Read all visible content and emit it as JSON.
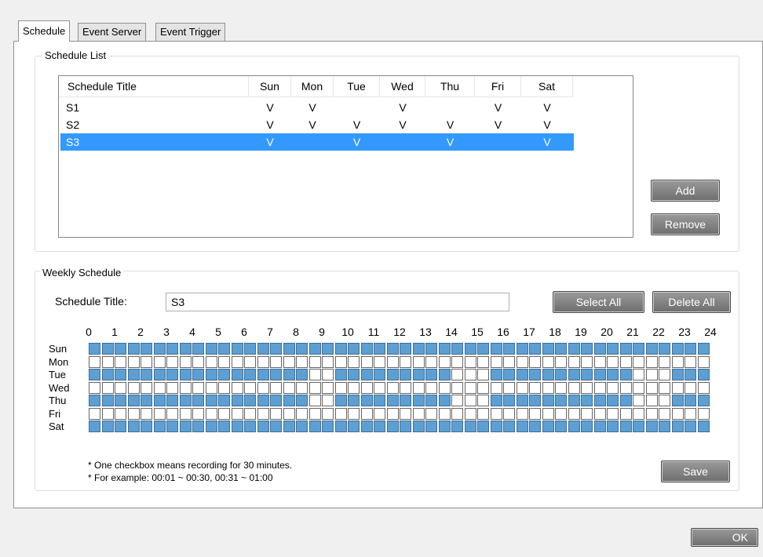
{
  "tabs": [
    "Schedule",
    "Event Server",
    "Event Trigger"
  ],
  "schedule_list": {
    "group_title": "Schedule List",
    "columns": [
      "Schedule Title",
      "Sun",
      "Mon",
      "Tue",
      "Wed",
      "Thu",
      "Fri",
      "Sat"
    ],
    "rows": [
      {
        "title": "S1",
        "days": [
          "V",
          "V",
          "",
          "V",
          "",
          "V",
          "V"
        ],
        "selected": false
      },
      {
        "title": "S2",
        "days": [
          "V",
          "V",
          "V",
          "V",
          "V",
          "V",
          "V"
        ],
        "selected": false
      },
      {
        "title": "S3",
        "days": [
          "V",
          "",
          "V",
          "",
          "V",
          "",
          "V"
        ],
        "selected": true
      }
    ],
    "add_label": "Add",
    "remove_label": "Remove"
  },
  "weekly": {
    "group_title": "Weekly Schedule",
    "title_label": "Schedule Title:",
    "title_value": "S3",
    "select_all_label": "Select All",
    "delete_all_label": "Delete All",
    "hours": [
      "0",
      "1",
      "2",
      "3",
      "4",
      "5",
      "6",
      "7",
      "8",
      "9",
      "10",
      "11",
      "12",
      "13",
      "14",
      "15",
      "16",
      "17",
      "18",
      "19",
      "20",
      "21",
      "22",
      "23",
      "24"
    ],
    "days": [
      "Sun",
      "Mon",
      "Tue",
      "Wed",
      "Thu",
      "Fri",
      "Sat"
    ],
    "grid": [
      "111111111111111111111111111111111111111111111111",
      "000000000000000000000000000000000000000000000000",
      "111111111111111110011111111100011111111111000111",
      "000000000000000000000000000000000000000000000000",
      "111111111111111110011111111100011111111111000111",
      "000000000000000000000000000000000000000000000000",
      "111111111111111111111111111111111111111111111111"
    ],
    "note1": "* One checkbox means recording for 30 minutes.",
    "note2": "* For example: 00:01 ~ 00:30, 00:31 ~ 01:00",
    "save_label": "Save"
  },
  "ok_label": "OK",
  "colors": {
    "selected_row": "#3399ff",
    "checked_box": "#5d9fd3"
  }
}
